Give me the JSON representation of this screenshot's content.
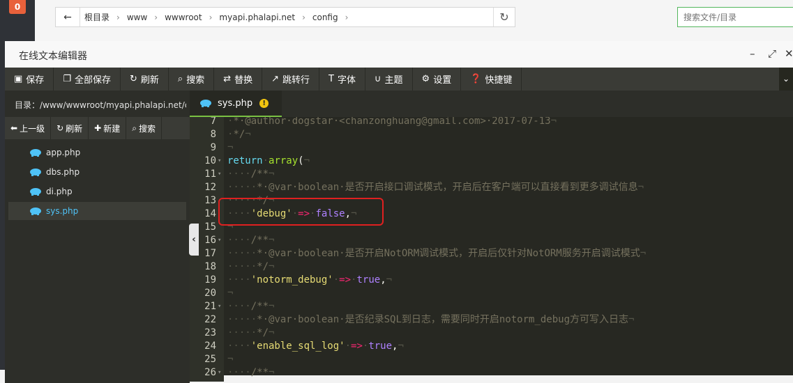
{
  "app": {
    "badge_count": "0"
  },
  "path_bar": {
    "crumbs": [
      "根目录",
      "www",
      "wwwroot",
      "myapi.phalapi.net",
      "config"
    ],
    "search_placeholder": "搜索文件/目录"
  },
  "editor": {
    "title": "在线文本编辑器",
    "toolbar": [
      "保存",
      "全部保存",
      "刷新",
      "搜索",
      "替换",
      "跳转行",
      "字体",
      "主题",
      "设置",
      "快捷键"
    ],
    "dir_label": "目录：/www/wwwroot/myapi.phalapi.net/c...",
    "side_tools": [
      "上一级",
      "刷新",
      "新建",
      "搜索"
    ],
    "files": [
      "app.php",
      "dbs.php",
      "di.php",
      "sys.php"
    ],
    "active_file": "sys.php",
    "tab_label": "sys.php",
    "tab_warning": "!"
  },
  "code_lines": [
    {
      "n": "7",
      "text": " * @author dogstar <chanzonghuang@gmail.com> 2017-07-13"
    },
    {
      "n": "8",
      "text": " */"
    },
    {
      "n": "9",
      "text": ""
    },
    {
      "n": "10",
      "text": "return array("
    },
    {
      "n": "11",
      "text": "    /**"
    },
    {
      "n": "12",
      "text": "     * @var boolean 是否开启接口调试模式，开启后在客户端可以直接看到更多调试信息"
    },
    {
      "n": "13",
      "text": "     */"
    },
    {
      "n": "14",
      "text": "    'debug' => false,"
    },
    {
      "n": "15",
      "text": ""
    },
    {
      "n": "16",
      "text": "    /**"
    },
    {
      "n": "17",
      "text": "     * @var boolean 是否开启NotORM调试模式，开启后仅针对NotORM服务开启调试模式"
    },
    {
      "n": "18",
      "text": "     */"
    },
    {
      "n": "19",
      "text": "    'notorm_debug' => true,"
    },
    {
      "n": "20",
      "text": ""
    },
    {
      "n": "21",
      "text": "    /**"
    },
    {
      "n": "22",
      "text": "     * @var boolean 是否纪录SQL到日志，需要同时开启notorm_debug方可写入日志"
    },
    {
      "n": "23",
      "text": "     */"
    },
    {
      "n": "24",
      "text": "    'enable_sql_log' => true,"
    },
    {
      "n": "25",
      "text": ""
    },
    {
      "n": "26",
      "text": "    /**"
    }
  ],
  "colors": {
    "accent_green": "#7ac143",
    "highlight_red": "#e02020",
    "php_blue": "#4fc3f7"
  }
}
